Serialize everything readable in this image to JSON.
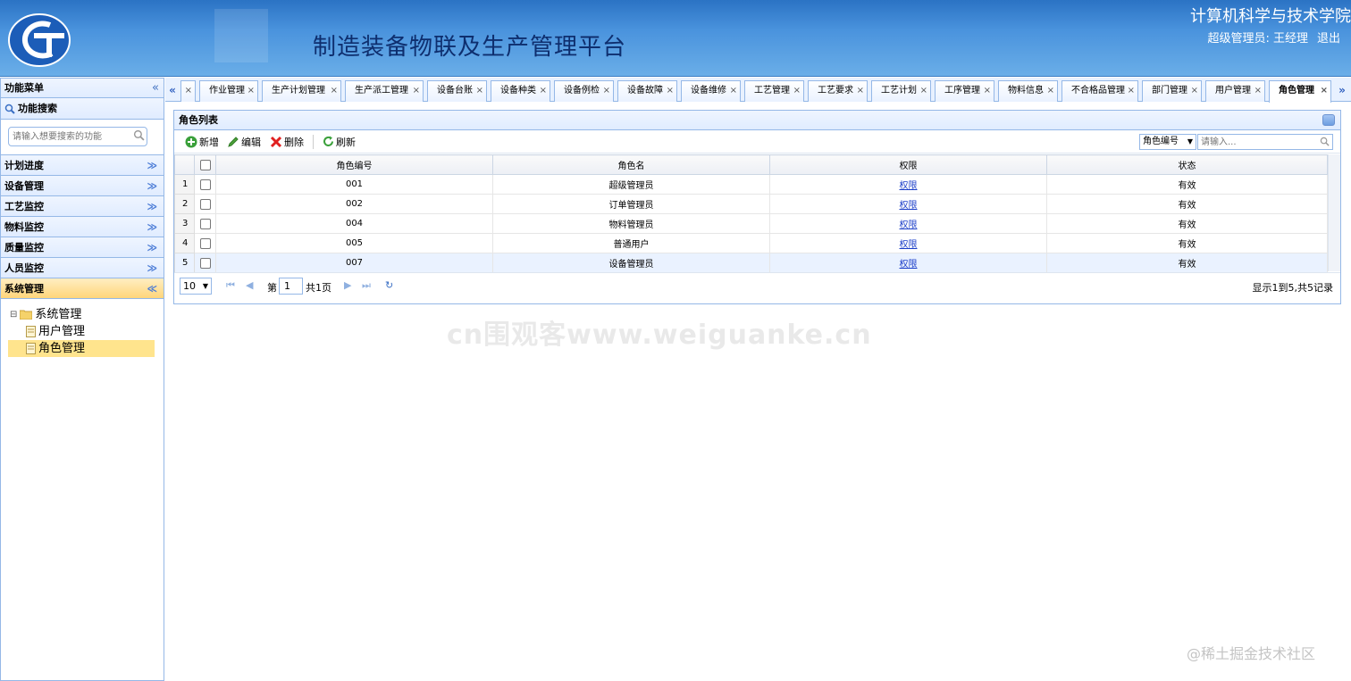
{
  "header": {
    "system_name": "制造装备物联及生产管理平台",
    "school_name": "计算机科学与技术学院",
    "user_label": "超级管理员: 王经理",
    "logout": "退出"
  },
  "sidebar": {
    "title": "功能菜单",
    "collapse_glyph": "«",
    "search_title": "功能搜索",
    "search_placeholder": "请输入想要搜索的功能",
    "sections": [
      {
        "label": "计划进度"
      },
      {
        "label": "设备管理"
      },
      {
        "label": "工艺监控"
      },
      {
        "label": "物料监控"
      },
      {
        "label": "质量监控"
      },
      {
        "label": "人员监控"
      },
      {
        "label": "系统管理"
      }
    ],
    "tree": {
      "root": "系统管理",
      "children": [
        "用户管理",
        "角色管理"
      ]
    }
  },
  "tabs": [
    {
      "label": ""
    },
    {
      "label": "作业管理"
    },
    {
      "label": "生产计划管理"
    },
    {
      "label": "生产派工管理"
    },
    {
      "label": "设备台账"
    },
    {
      "label": "设备种类"
    },
    {
      "label": "设备例检"
    },
    {
      "label": "设备故障"
    },
    {
      "label": "设备维修"
    },
    {
      "label": "工艺管理"
    },
    {
      "label": "工艺要求"
    },
    {
      "label": "工艺计划"
    },
    {
      "label": "工序管理"
    },
    {
      "label": "物料信息"
    },
    {
      "label": "不合格品管理"
    },
    {
      "label": "部门管理"
    },
    {
      "label": "用户管理"
    },
    {
      "label": "角色管理"
    }
  ],
  "panel": {
    "title": "角色列表",
    "toolbar": {
      "add": "新增",
      "edit": "编辑",
      "delete": "删除",
      "refresh": "刷新",
      "field_select": "角色编号",
      "keyword_placeholder": "请输入..."
    },
    "columns": [
      "角色编号",
      "角色名",
      "权限",
      "状态"
    ],
    "rows": [
      {
        "no": "1",
        "code": "001",
        "name": "超级管理员",
        "perm": "权限",
        "status": "有效"
      },
      {
        "no": "2",
        "code": "002",
        "name": "订单管理员",
        "perm": "权限",
        "status": "有效"
      },
      {
        "no": "3",
        "code": "004",
        "name": "物料管理员",
        "perm": "权限",
        "status": "有效"
      },
      {
        "no": "4",
        "code": "005",
        "name": "普通用户",
        "perm": "权限",
        "status": "有效"
      },
      {
        "no": "5",
        "code": "007",
        "name": "设备管理员",
        "perm": "权限",
        "status": "有效"
      }
    ],
    "pager": {
      "page_size": "10",
      "page_prefix": "第",
      "page_value": "1",
      "page_total": "共1页",
      "info": "显示1到5,共5记录"
    }
  },
  "watermarks": {
    "center": "cn围观客www.weiguanke.cn",
    "corner": "@稀土掘金技术社区"
  },
  "colors": {
    "header_bg": "#4a93dd",
    "border": "#95b8e7",
    "selected": "#ffe48d",
    "link": "#1a3dc8"
  }
}
